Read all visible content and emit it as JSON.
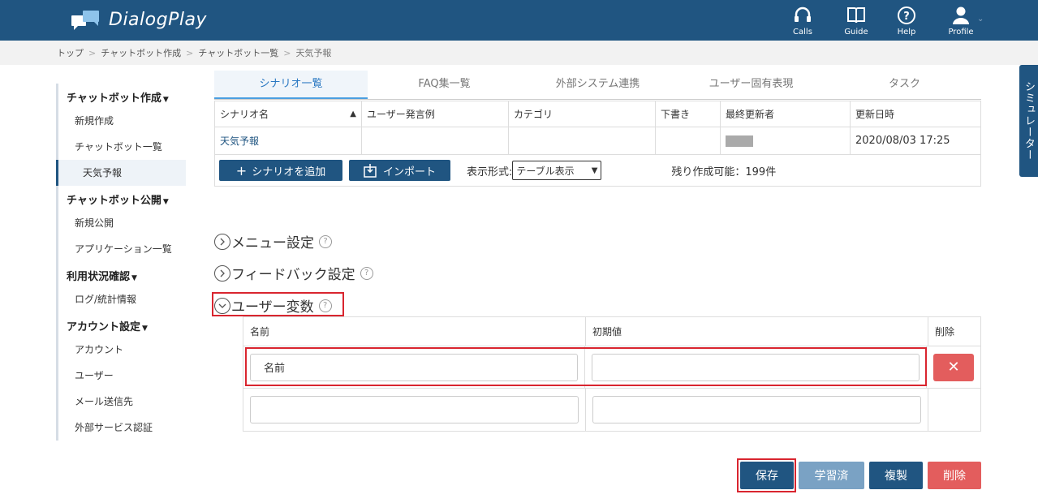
{
  "header": {
    "app_name": "DialogPlay",
    "nav": [
      {
        "label": "Calls",
        "icon": "headset-icon"
      },
      {
        "label": "Guide",
        "icon": "book-icon"
      },
      {
        "label": "Help",
        "icon": "help-circle-icon"
      },
      {
        "label": "Profile",
        "icon": "user-icon"
      }
    ]
  },
  "breadcrumb": [
    "トップ",
    "チャットボット作成",
    "チャットボット一覧",
    "天気予報"
  ],
  "sidebar": {
    "groups": [
      {
        "label": "チャットボット作成",
        "items": [
          "新規作成",
          "チャットボット一覧",
          "天気予報"
        ]
      },
      {
        "label": "チャットボット公開",
        "items": [
          "新規公開",
          "アプリケーション一覧"
        ]
      },
      {
        "label": "利用状況確認",
        "items": [
          "ログ/統計情報"
        ]
      },
      {
        "label": "アカウント設定",
        "items": [
          "アカウント",
          "ユーザー",
          "メール送信先",
          "外部サービス認証"
        ]
      }
    ],
    "active_item": "天気予報"
  },
  "tabs": [
    "シナリオ一覧",
    "FAQ集一覧",
    "外部システム連携",
    "ユーザー固有表現",
    "タスク"
  ],
  "scenario_table": {
    "headers": [
      "シナリオ名",
      "ユーザー発言例",
      "カテゴリ",
      "下書き",
      "最終更新者",
      "更新日時"
    ],
    "sort_indicator": "▲",
    "row": {
      "name": "天気予報",
      "example": "",
      "category": "",
      "draft": "",
      "updated_by": "",
      "updated_at": "2020/08/03 17:25"
    },
    "add_button": "シナリオを追加",
    "import_button": "インポート",
    "display_label": "表示形式:",
    "display_value": "テーブル表示",
    "remaining": "残り作成可能：199件"
  },
  "sections": {
    "menu": "メニュー設定",
    "feedback": "フィードバック設定",
    "user_vars": "ユーザー変数",
    "help_glyph": "?"
  },
  "variables_table": {
    "headers": [
      "名前",
      "初期値",
      "削除"
    ],
    "rows": [
      {
        "name": "名前",
        "initial": ""
      },
      {
        "name": "",
        "initial": ""
      }
    ]
  },
  "buttons": {
    "save": "保存",
    "learned": "学習済",
    "duplicate": "複製",
    "delete": "削除"
  },
  "simulator": "シミュレーター",
  "colors": {
    "header": "#205581",
    "accent": "#4a9ee0",
    "danger": "#e35d5d",
    "highlight": "#d9252f"
  }
}
